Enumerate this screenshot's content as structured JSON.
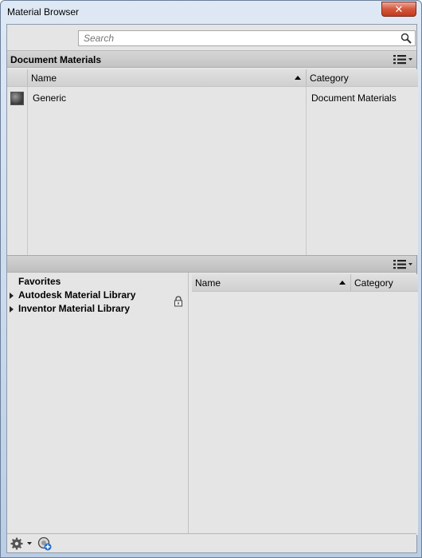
{
  "window": {
    "title": "Material Browser",
    "close_glyph": "✕"
  },
  "search": {
    "placeholder": "Search",
    "value": ""
  },
  "document_materials": {
    "header": "Document Materials",
    "columns": [
      {
        "label": "Name",
        "sorted": "ascending"
      },
      {
        "label": "Category"
      }
    ],
    "rows": [
      {
        "name": "Generic",
        "category": "Document Materials",
        "icon": "material-swatch"
      }
    ]
  },
  "library_tree": {
    "items": [
      {
        "label": "Favorites",
        "expandable": false
      },
      {
        "label": "Autodesk Material Library",
        "expandable": true,
        "locked": true
      },
      {
        "label": "Inventor Material Library",
        "expandable": true
      }
    ]
  },
  "library_table": {
    "columns": [
      {
        "label": "Name",
        "sorted": "ascending"
      },
      {
        "label": "Category"
      }
    ],
    "rows": []
  },
  "footer": {
    "buttons": [
      "gear-icon",
      "add-library-icon"
    ]
  },
  "colors": {
    "panel": "#e5e5e5",
    "header": "#c9c9c9",
    "close": "#c94a30"
  }
}
